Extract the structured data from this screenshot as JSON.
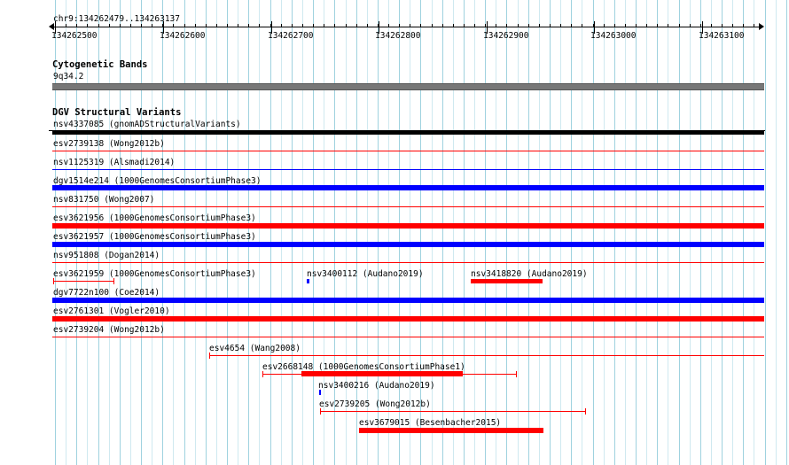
{
  "colors": {
    "loss": "#ff0000",
    "gain": "#0000ff",
    "complex": "#000000",
    "band": "#777777",
    "grid_major": "#9fd2df",
    "grid_minor": "#cfe9f0"
  },
  "ruler": {
    "location": "chr9:134262479..134263137",
    "ticks": [
      "134262500",
      "134262600",
      "134262700",
      "134262800",
      "134262900",
      "134263000",
      "134263100"
    ]
  },
  "cytoband": {
    "title": "Cytogenetic Bands",
    "band": "9q34.2"
  },
  "dgv": {
    "title": "DGV Structural Variants",
    "rows": [
      {
        "label": "nsv4337085 (gnomADStructuralVariants)",
        "type": "complex"
      },
      {
        "label": "esv2739138 (Wong2012b)",
        "type": "loss"
      },
      {
        "label": "nsv1125319 (Alsmadi2014)",
        "type": "gain"
      },
      {
        "label": "dgv1514e214 (1000GenomesConsortiumPhase3)",
        "type": "gain"
      },
      {
        "label": "nsv831750 (Wong2007)",
        "type": "loss"
      },
      {
        "label": "esv3621956 (1000GenomesConsortiumPhase3)",
        "type": "loss"
      },
      {
        "label": "esv3621957 (1000GenomesConsortiumPhase3)",
        "type": "gain"
      },
      {
        "label": "nsv951808 (Dogan2014)",
        "type": "loss"
      },
      {
        "label": "esv3621959 (1000GenomesConsortiumPhase3)",
        "type": "loss"
      },
      {
        "label": "nsv3400112 (Audano2019)",
        "type": "gain"
      },
      {
        "label": "nsv3418820 (Audano2019)",
        "type": "loss"
      },
      {
        "label": "dgv7722n100 (Coe2014)",
        "type": "gain"
      },
      {
        "label": "esv2761301 (Vogler2010)",
        "type": "loss"
      },
      {
        "label": "esv2739204 (Wong2012b)",
        "type": "loss"
      },
      {
        "label": "esv4654 (Wang2008)",
        "type": "loss"
      },
      {
        "label": "esv2668148 (1000GenomesConsortiumPhase1)",
        "type": "loss"
      },
      {
        "label": "nsv3400216 (Audano2019)",
        "type": "gain"
      },
      {
        "label": "esv2739205 (Wong2012b)",
        "type": "loss"
      },
      {
        "label": "esv3679015 (Besenbacher2015)",
        "type": "loss"
      }
    ]
  }
}
